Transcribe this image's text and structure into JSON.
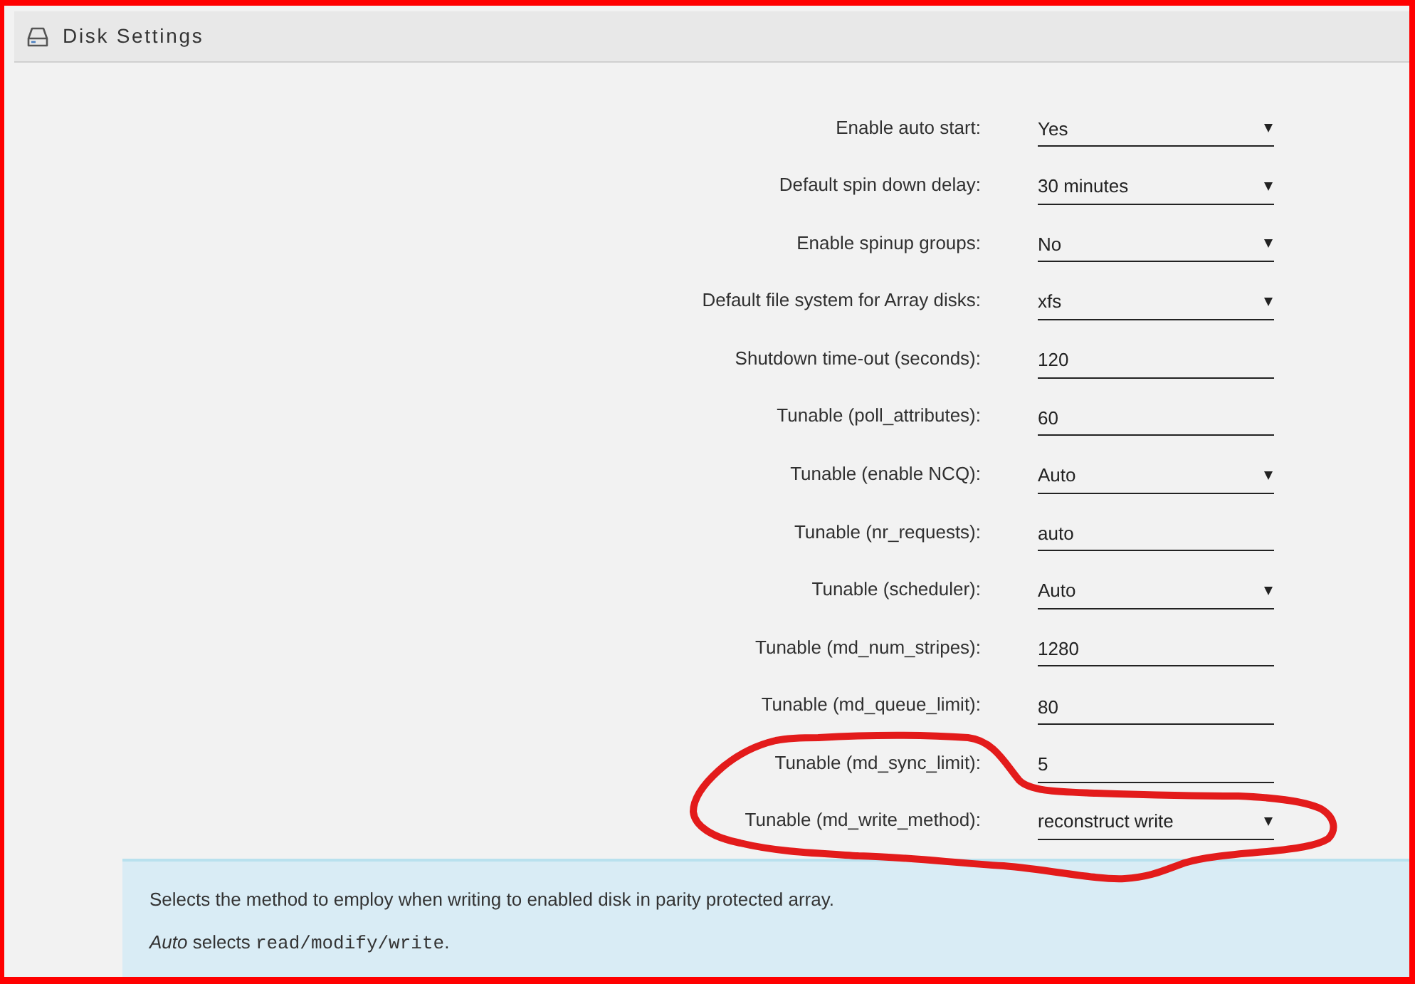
{
  "header": {
    "title": "Disk Settings"
  },
  "settings": [
    {
      "label": "Enable auto start:",
      "kind": "select",
      "value": "Yes"
    },
    {
      "label": "Default spin down delay:",
      "kind": "select",
      "value": "30 minutes"
    },
    {
      "label": "Enable spinup groups:",
      "kind": "select",
      "value": "No"
    },
    {
      "label": "Default file system for Array disks:",
      "kind": "select",
      "value": "xfs"
    },
    {
      "label": "Shutdown time-out (seconds):",
      "kind": "text",
      "value": "120"
    },
    {
      "label": "Tunable (poll_attributes):",
      "kind": "text",
      "value": "60"
    },
    {
      "label": "Tunable (enable NCQ):",
      "kind": "select",
      "value": "Auto"
    },
    {
      "label": "Tunable (nr_requests):",
      "kind": "text",
      "value": "auto"
    },
    {
      "label": "Tunable (scheduler):",
      "kind": "select",
      "value": "Auto"
    },
    {
      "label": "Tunable (md_num_stripes):",
      "kind": "text",
      "value": "1280"
    },
    {
      "label": "Tunable (md_queue_limit):",
      "kind": "text",
      "value": "80"
    },
    {
      "label": "Tunable (md_sync_limit):",
      "kind": "text",
      "value": "5"
    },
    {
      "label": "Tunable (md_write_method):",
      "kind": "select",
      "value": "reconstruct write"
    }
  ],
  "help": {
    "paragraphs": [
      {
        "text": "Selects the method to employ when writing to enabled disk in parity protected array."
      },
      {
        "text": "*Auto* selects",
        "code": "read/modify/write",
        "tail": "."
      }
    ]
  }
}
